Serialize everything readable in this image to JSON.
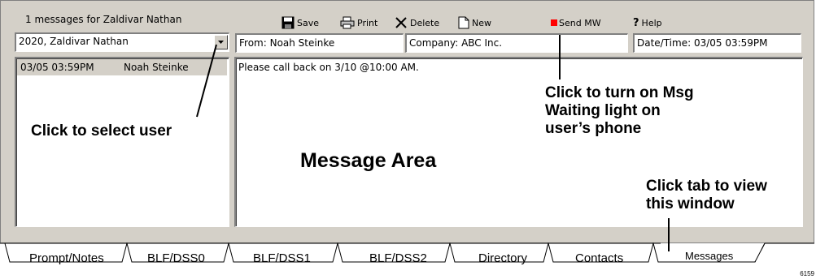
{
  "header": {
    "message_count": "1 messages for Zaldivar Nathan"
  },
  "user_select": {
    "value": "2020, Zaldivar Nathan"
  },
  "toolbar": {
    "save_label": "Save",
    "print_label": "Print",
    "delete_label": "Delete",
    "new_label": "New",
    "send_mw_label": "Send MW",
    "help_label": "Help",
    "help_prefix": "?"
  },
  "message_header": {
    "from": "From: Noah Steinke",
    "company": "Company: ABC Inc.",
    "datetime": "Date/Time: 03/05 03:59PM"
  },
  "message_list": [
    {
      "time": "03/05 03:59PM",
      "sender": "Noah Steinke"
    }
  ],
  "message_body": "Please call back on 3/10 @10:00 AM.",
  "callouts": {
    "select_user": "Click to select user",
    "msg_waiting_line1": "Click to turn on Msg",
    "msg_waiting_line2": "Waiting light on",
    "msg_waiting_line3": "user’s phone",
    "message_area": "Message Area",
    "tab_view_line1": "Click tab to view",
    "tab_view_line2": "this window"
  },
  "tabs": [
    {
      "label": "Prompt/Notes"
    },
    {
      "label": "BLF/DSS0"
    },
    {
      "label": "BLF/DSS1"
    },
    {
      "label": "BLF/DSS2"
    },
    {
      "label": "Directory"
    },
    {
      "label": "Contacts"
    },
    {
      "label": "Messages",
      "active": true
    }
  ],
  "figure_number": "6159",
  "colors": {
    "panel": "#d4d0c8",
    "send_mw_icon": "#ff0000",
    "selected_row": "#d4d0c8"
  },
  "icons": [
    "floppy-save-icon",
    "printer-icon",
    "delete-x-icon",
    "new-document-icon",
    "send-mw-red-square-icon",
    "dropdown-arrow-icon"
  ]
}
